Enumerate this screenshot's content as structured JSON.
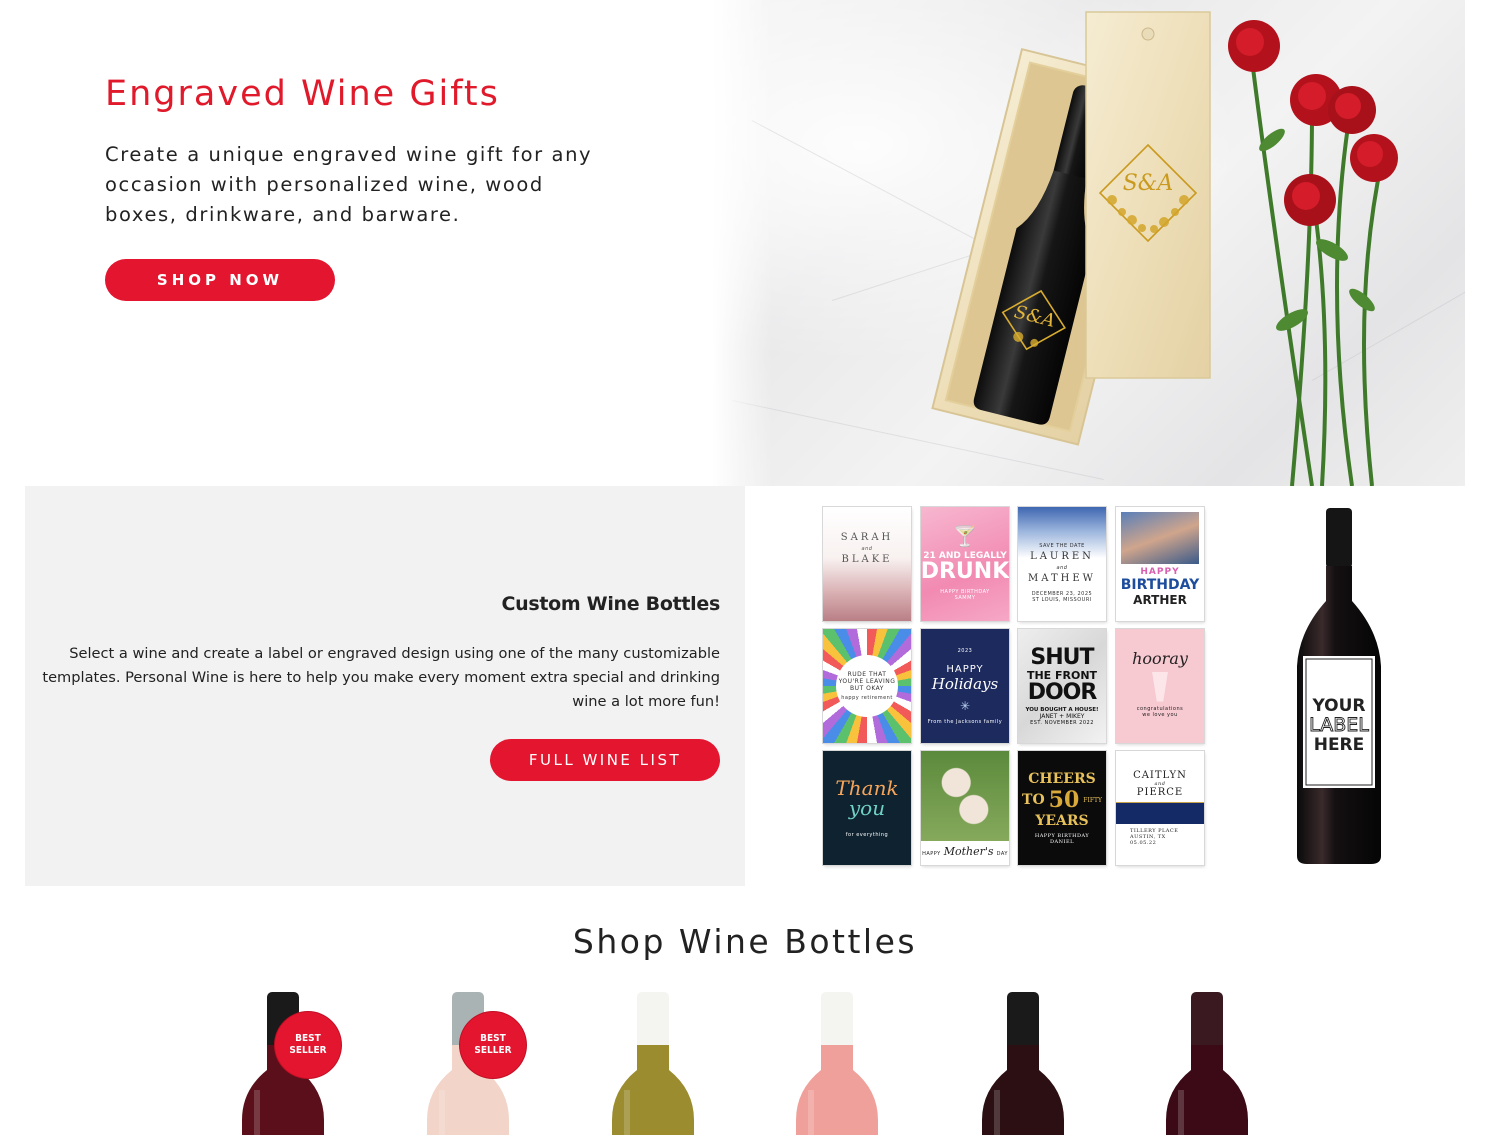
{
  "hero": {
    "title": "Engraved Wine Gifts",
    "description": "Create a unique engraved wine gift for any occasion with personalized wine, wood boxes, drinkware, and barware.",
    "cta_label": "SHOP NOW",
    "box_monogram": "S&A",
    "bottle_monogram": "S&A"
  },
  "custom": {
    "title": "Custom Wine Bottles",
    "description": "Select a wine and create a label or engraved design using one of the many customizable templates. Personal Wine is here to help you make every moment extra special and drinking wine a lot more fun!",
    "cta_label": "FULL WINE LIST",
    "bottle_label": [
      "YOUR",
      "LABEL",
      "HERE"
    ]
  },
  "labels": [
    {
      "id": "sarah-blake",
      "lines": [
        "SARAH",
        "and",
        "BLAKE"
      ]
    },
    {
      "id": "legally-drunk",
      "lines": [
        "21 AND LEGALLY",
        "DRUNK",
        "HAPPY BIRTHDAY",
        "SAMMY"
      ]
    },
    {
      "id": "lauren-mathew",
      "lines": [
        "SAVE THE DATE",
        "LAUREN",
        "and",
        "MATHEW",
        "DECEMBER 23, 2025",
        "ST LOUIS, MISSOURI"
      ]
    },
    {
      "id": "birthday-arther",
      "lines": [
        "HAPPY",
        "BIRTHDAY",
        "ARTHER"
      ]
    },
    {
      "id": "retirement",
      "lines": [
        "RUDE THAT",
        "YOU'RE LEAVING",
        "BUT OKAY",
        "happy retirement"
      ]
    },
    {
      "id": "holidays",
      "lines": [
        "2023",
        "HAPPY",
        "Holidays",
        "From the Jacksons family"
      ]
    },
    {
      "id": "shut-door",
      "lines": [
        "SHUT",
        "THE FRONT",
        "DOOR",
        "YOU BOUGHT A HOUSE!",
        "JANET + MIKEY",
        "EST. NOVEMBER 2022"
      ]
    },
    {
      "id": "hooray",
      "lines": [
        "hooray",
        "congratulations",
        "we love you"
      ]
    },
    {
      "id": "thank-you",
      "lines": [
        "Thank",
        "you",
        "for everything"
      ]
    },
    {
      "id": "mothers-day",
      "lines": [
        "HAPPY",
        "Mother's",
        "DAY"
      ]
    },
    {
      "id": "cheers-50",
      "lines": [
        "CHEERS",
        "TO",
        "50",
        "FIFTY",
        "YEARS",
        "HAPPY BIRTHDAY",
        "DANIEL"
      ]
    },
    {
      "id": "caitlyn-pierce",
      "lines": [
        "CAITLYN",
        "and",
        "PIERCE",
        "TILLERY PLACE",
        "AUSTIN, TX",
        "05.05.22"
      ]
    }
  ],
  "shop": {
    "title": "Shop Wine Bottles",
    "products": [
      {
        "badge": [
          "BEST",
          "SELLER"
        ],
        "wine_color": "#5a0f1a",
        "capsule": "#1a1a1a"
      },
      {
        "badge": [
          "BEST",
          "SELLER"
        ],
        "wine_color": "#f2d4c8",
        "capsule": "#a9b3b4"
      },
      {
        "badge": null,
        "wine_color": "#9a8c2f",
        "capsule": "#f4f4f0"
      },
      {
        "badge": null,
        "wine_color": "#f0a09a",
        "capsule": "#f4f4f0"
      },
      {
        "badge": null,
        "wine_color": "#2b0f12",
        "capsule": "#1a1a1a"
      },
      {
        "badge": null,
        "wine_color": "#3b0a16",
        "capsule": "#3a1a20"
      }
    ]
  },
  "colors": {
    "accent": "#e3152f",
    "title_red": "#e0192b",
    "panel_bg": "#f2f2f2"
  }
}
